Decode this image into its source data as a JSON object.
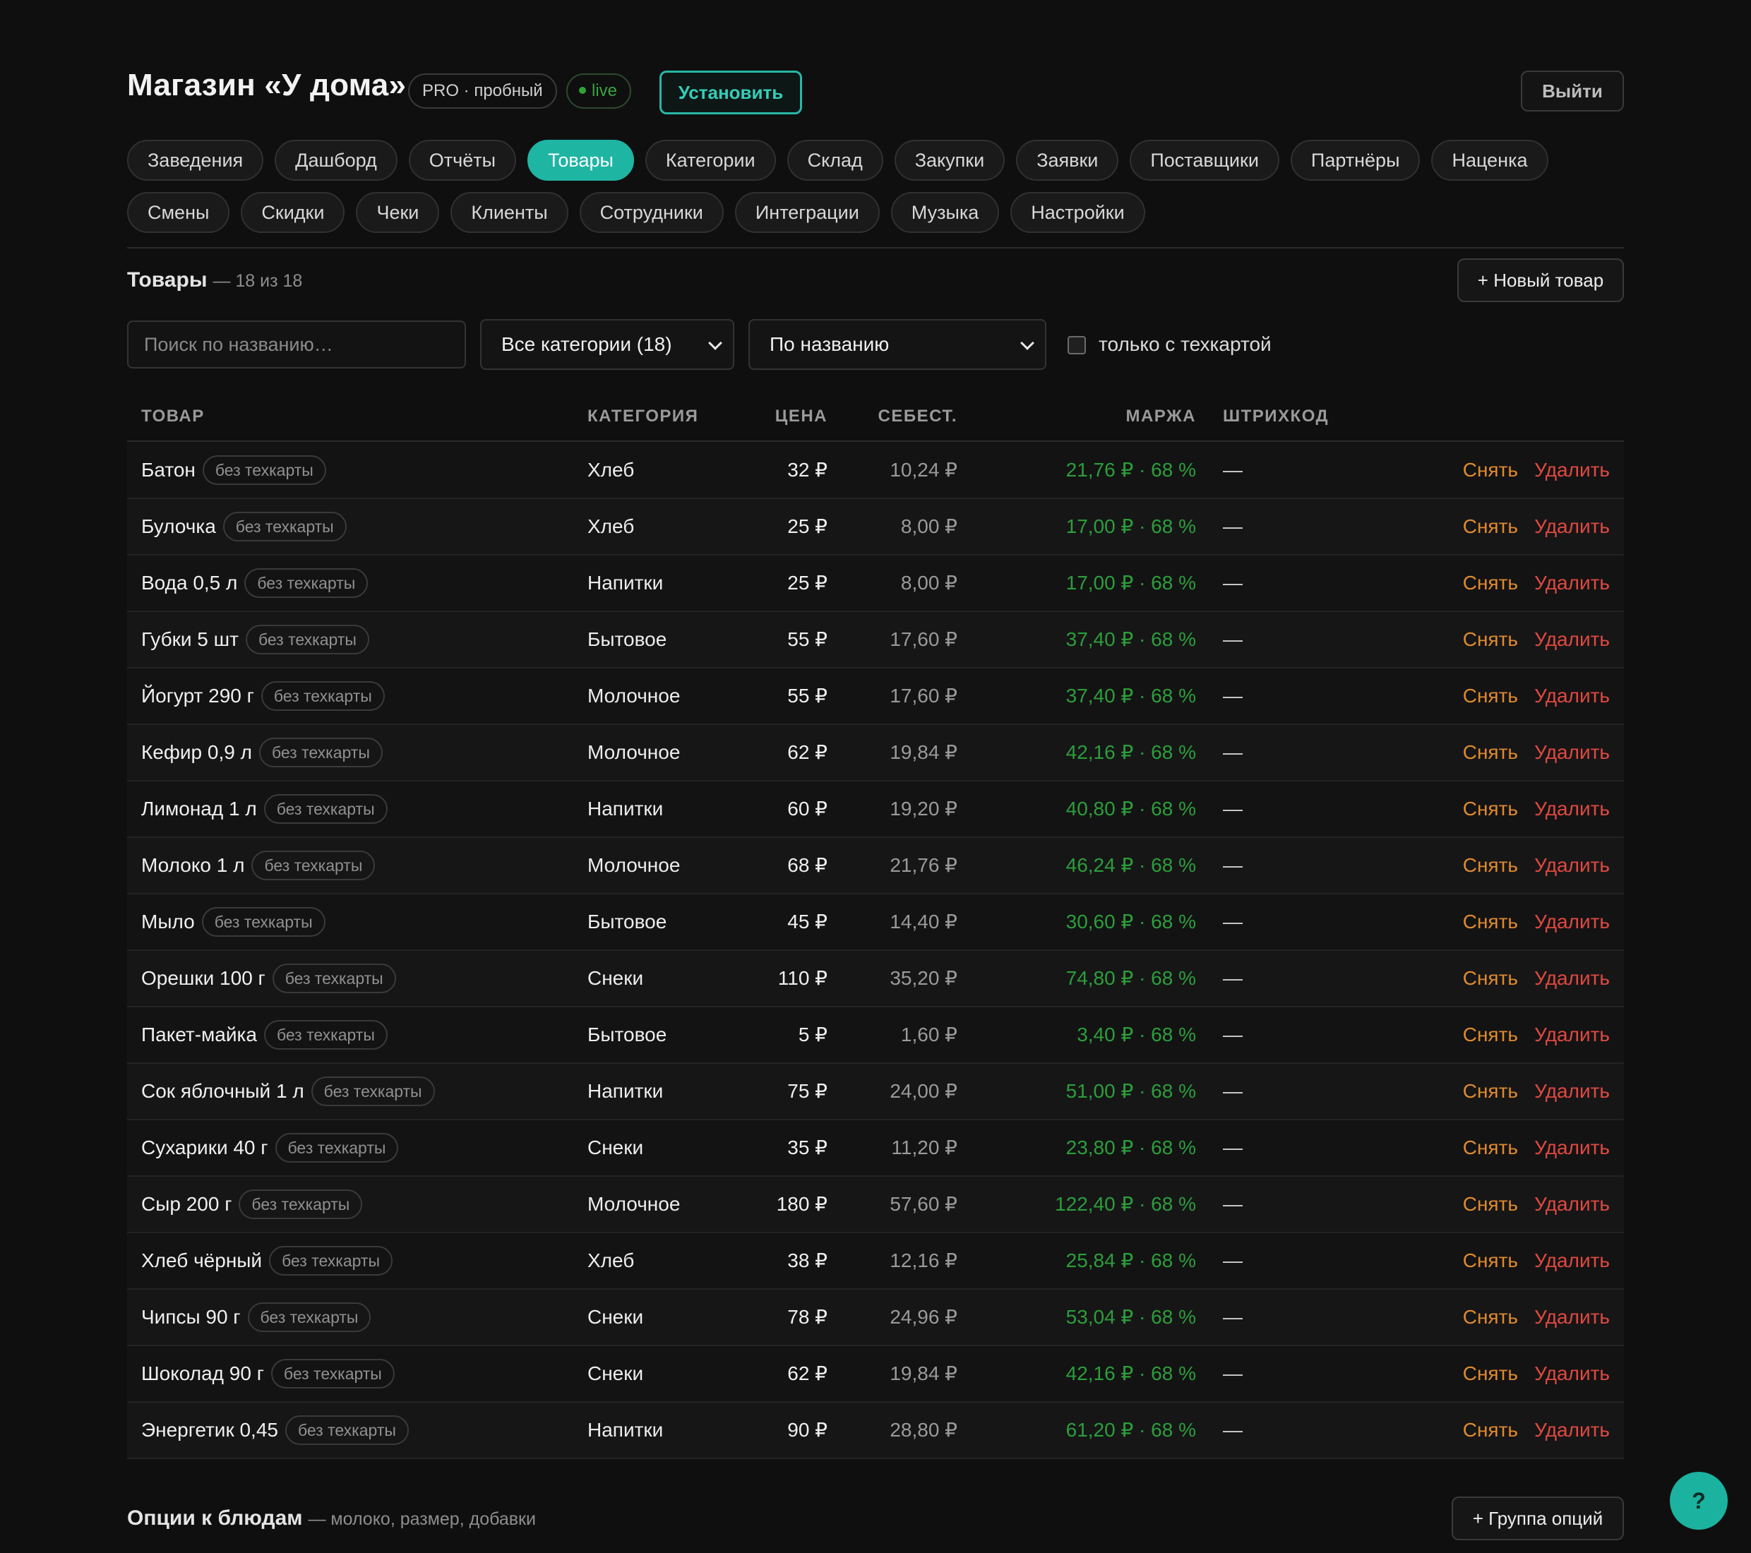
{
  "header": {
    "title": "Магазин «У дома»",
    "plan": "PRO · пробный",
    "live": "live",
    "install": "Установить",
    "logout": "Выйти"
  },
  "nav": [
    {
      "label": "Заведения",
      "active": false
    },
    {
      "label": "Дашборд",
      "active": false
    },
    {
      "label": "Отчёты",
      "active": false
    },
    {
      "label": "Товары",
      "active": true
    },
    {
      "label": "Категории",
      "active": false
    },
    {
      "label": "Склад",
      "active": false
    },
    {
      "label": "Закупки",
      "active": false
    },
    {
      "label": "Заявки",
      "active": false
    },
    {
      "label": "Поставщики",
      "active": false
    },
    {
      "label": "Партнёры",
      "active": false
    },
    {
      "label": "Наценка",
      "active": false
    },
    {
      "label": "Смены",
      "active": false
    },
    {
      "label": "Скидки",
      "active": false
    },
    {
      "label": "Чеки",
      "active": false
    },
    {
      "label": "Клиенты",
      "active": false
    },
    {
      "label": "Сотрудники",
      "active": false
    },
    {
      "label": "Интеграции",
      "active": false
    },
    {
      "label": "Музыка",
      "active": false
    },
    {
      "label": "Настройки",
      "active": false
    }
  ],
  "products": {
    "title": "Товары",
    "count": "— 18 из 18",
    "new_button": "+ Новый товар",
    "search_placeholder": "Поиск по названию…",
    "category_filter": "Все категории (18)",
    "sort": "По названию",
    "techcard_only": "только с техкартой",
    "columns": {
      "name": "ТОВАР",
      "category": "КАТЕГОРИЯ",
      "price": "ЦЕНА",
      "cost": "СЕБЕСТ.",
      "margin": "МАРЖА",
      "barcode": "ШТРИХКОД"
    },
    "action_remove": "Снять",
    "action_delete": "Удалить",
    "rows": [
      {
        "name": "Батон",
        "tag": "без техкарты",
        "category": "Хлеб",
        "price": "32 ₽",
        "cost": "10,24 ₽",
        "margin": "21,76 ₽ · 68 %",
        "barcode": "—"
      },
      {
        "name": "Булочка",
        "tag": "без техкарты",
        "category": "Хлеб",
        "price": "25 ₽",
        "cost": "8,00 ₽",
        "margin": "17,00 ₽ · 68 %",
        "barcode": "—"
      },
      {
        "name": "Вода 0,5 л",
        "tag": "без техкарты",
        "category": "Напитки",
        "price": "25 ₽",
        "cost": "8,00 ₽",
        "margin": "17,00 ₽ · 68 %",
        "barcode": "—"
      },
      {
        "name": "Губки 5 шт",
        "tag": "без техкарты",
        "category": "Бытовое",
        "price": "55 ₽",
        "cost": "17,60 ₽",
        "margin": "37,40 ₽ · 68 %",
        "barcode": "—"
      },
      {
        "name": "Йогурт 290 г",
        "tag": "без техкарты",
        "category": "Молочное",
        "price": "55 ₽",
        "cost": "17,60 ₽",
        "margin": "37,40 ₽ · 68 %",
        "barcode": "—"
      },
      {
        "name": "Кефир 0,9 л",
        "tag": "без техкарты",
        "category": "Молочное",
        "price": "62 ₽",
        "cost": "19,84 ₽",
        "margin": "42,16 ₽ · 68 %",
        "barcode": "—"
      },
      {
        "name": "Лимонад 1 л",
        "tag": "без техкарты",
        "category": "Напитки",
        "price": "60 ₽",
        "cost": "19,20 ₽",
        "margin": "40,80 ₽ · 68 %",
        "barcode": "—"
      },
      {
        "name": "Молоко 1 л",
        "tag": "без техкарты",
        "category": "Молочное",
        "price": "68 ₽",
        "cost": "21,76 ₽",
        "margin": "46,24 ₽ · 68 %",
        "barcode": "—"
      },
      {
        "name": "Мыло",
        "tag": "без техкарты",
        "category": "Бытовое",
        "price": "45 ₽",
        "cost": "14,40 ₽",
        "margin": "30,60 ₽ · 68 %",
        "barcode": "—"
      },
      {
        "name": "Орешки 100 г",
        "tag": "без техкарты",
        "category": "Снеки",
        "price": "110 ₽",
        "cost": "35,20 ₽",
        "margin": "74,80 ₽ · 68 %",
        "barcode": "—"
      },
      {
        "name": "Пакет-майка",
        "tag": "без техкарты",
        "category": "Бытовое",
        "price": "5 ₽",
        "cost": "1,60 ₽",
        "margin": "3,40 ₽ · 68 %",
        "barcode": "—"
      },
      {
        "name": "Сок яблочный 1 л",
        "tag": "без техкарты",
        "category": "Напитки",
        "price": "75 ₽",
        "cost": "24,00 ₽",
        "margin": "51,00 ₽ · 68 %",
        "barcode": "—"
      },
      {
        "name": "Сухарики 40 г",
        "tag": "без техкарты",
        "category": "Снеки",
        "price": "35 ₽",
        "cost": "11,20 ₽",
        "margin": "23,80 ₽ · 68 %",
        "barcode": "—"
      },
      {
        "name": "Сыр 200 г",
        "tag": "без техкарты",
        "category": "Молочное",
        "price": "180 ₽",
        "cost": "57,60 ₽",
        "margin": "122,40 ₽ · 68 %",
        "barcode": "—"
      },
      {
        "name": "Хлеб чёрный",
        "tag": "без техкарты",
        "category": "Хлеб",
        "price": "38 ₽",
        "cost": "12,16 ₽",
        "margin": "25,84 ₽ · 68 %",
        "barcode": "—"
      },
      {
        "name": "Чипсы 90 г",
        "tag": "без техкарты",
        "category": "Снеки",
        "price": "78 ₽",
        "cost": "24,96 ₽",
        "margin": "53,04 ₽ · 68 %",
        "barcode": "—"
      },
      {
        "name": "Шоколад 90 г",
        "tag": "без техкарты",
        "category": "Снеки",
        "price": "62 ₽",
        "cost": "19,84 ₽",
        "margin": "42,16 ₽ · 68 %",
        "barcode": "—"
      },
      {
        "name": "Энергетик 0,45",
        "tag": "без техкарты",
        "category": "Напитки",
        "price": "90 ₽",
        "cost": "28,80 ₽",
        "margin": "61,20 ₽ · 68 %",
        "barcode": "—"
      }
    ]
  },
  "options": {
    "title": "Опции к блюдам",
    "subtitle": "— молоко, размер, добавки",
    "add_button": "+ Группа опций"
  },
  "help": "?",
  "colors": {
    "accent": "#1fb5a3",
    "margin": "#2c9e3a",
    "remove": "#e08a2c",
    "delete": "#e0493f"
  }
}
